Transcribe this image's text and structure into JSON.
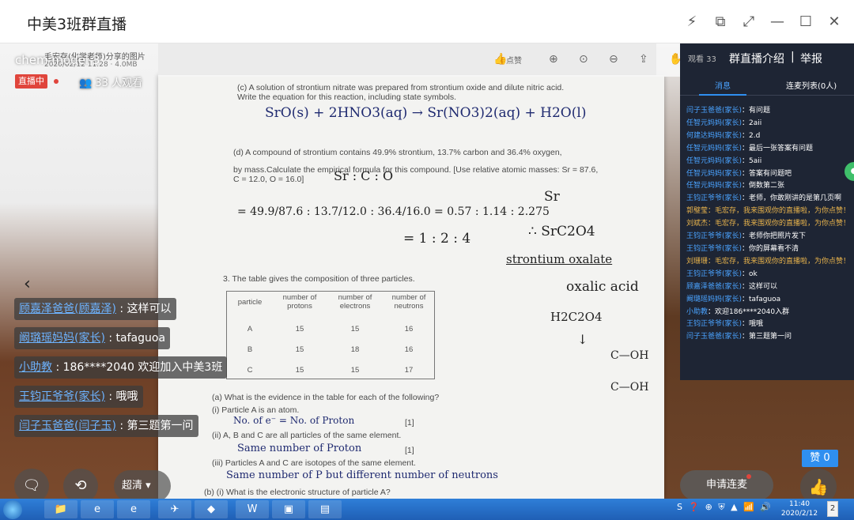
{
  "window": {
    "title": "中美3班群直播",
    "controls": [
      "⚡",
      "⧉",
      "⤢",
      "—",
      "☐",
      "✕"
    ]
  },
  "viewer": {
    "room_name": "chem model 3",
    "image_meta": "毛宏存(化学老师)分享的图片",
    "image_meta2": "2020/02/12 11:28 · 4.0MB",
    "like_label": "点赞",
    "toolbar_icons": [
      "like-icon",
      "zoom-in-icon",
      "zoom-out-icon",
      "zoom-reset-icon",
      "share-icon",
      "hand-icon"
    ]
  },
  "live": {
    "badge": "直播中",
    "viewers": "33 人观看"
  },
  "worksheet": {
    "q_top": "(c) A solution of strontium nitrate was prepared from strontium oxide and dilute nitric acid.",
    "q_top2": "Write the equation for this reaction, including state symbols.",
    "hw_eq1": "SrO(s) + 2HNO3(aq) →  Sr(NO3)2(aq) +  H2O(l)",
    "q_d": "(d) A compound of strontium contains 49.9% strontium, 13.7% carbon and 36.4% oxygen,",
    "q_d2": "by mass.Calculate the empirical formula for this compound. [Use relative atomic masses: Sr = 87.6,",
    "q_d3": "C = 12.0, O = 16.0]",
    "hw_ratio_head": "Sr : C : O",
    "hw_calc": "= 49.9/87.6 : 13.7/12.0 : 36.4/16.0 = 0.57 : 1.14 : 2.275",
    "hw_simpl": "= 1 : 2 : 4",
    "hw_sr": "Sr",
    "hw_formula": "∴ SrC2O4",
    "hw_name": "strontium oxalate",
    "hw_acid": "oxalic acid",
    "hw_acid_f": "H2C2O4",
    "hw_arrow": "↓",
    "hw_struct": "C—OH",
    "hw_struct2": "C—OH",
    "q3": "3. The table gives the composition of three particles.",
    "table": {
      "headers": [
        "particle",
        "number of protons",
        "number of electrons",
        "number of neutrons"
      ],
      "rows": [
        [
          "A",
          "15",
          "15",
          "16"
        ],
        [
          "B",
          "15",
          "18",
          "16"
        ],
        [
          "C",
          "15",
          "15",
          "17"
        ]
      ]
    },
    "qa": "(a) What is the evidence in the table for each of the following?",
    "qa_i": "(i) Particle A is an atom.",
    "hw_ai": "No. of e⁻ = No. of Proton",
    "mark1": "[1]",
    "qa_ii": "(ii) A, B and C are all particles of the same element.",
    "hw_aii": "Same number of Proton",
    "mark2": "[1]",
    "qa_iii": "(iii) Particles A and C are isotopes of the same element.",
    "hw_aiii": "Same number of P but different number of neutrons",
    "qb": "(b) (i) What is the electronic structure of particle A?"
  },
  "danmaku": [
    {
      "user": "顾嘉泽爸爸(顾嘉泽)",
      "text": " : 这样可以"
    },
    {
      "user": "阚璐瑶妈妈(家长)",
      "text": " : tafaguoa"
    },
    {
      "user": "小助教",
      "text": " : 186****2040 欢迎加入中美3班"
    },
    {
      "user": "王钧正爷爷(家长)",
      "text": " : 哦哦"
    },
    {
      "user": "闫子玉爸爸(闫子玉)",
      "text": " : 第三题第一问"
    }
  ],
  "controls": {
    "quality": "超清",
    "apply": "申请连麦",
    "zan": "赞 0"
  },
  "chat": {
    "watch": "观看 33",
    "intro": "群直播介绍",
    "sep": "|",
    "report": "举报",
    "tab_msgs": "消息",
    "tab_mic": "连麦列表(0人)",
    "messages": [
      {
        "user": "闫子玉爸爸(家长)",
        "text": "：有问题",
        "sys": false
      },
      {
        "user": "任智元妈妈(家长)",
        "text": "：2aii",
        "sys": false
      },
      {
        "user": "何建达妈妈(家长)",
        "text": "：2.d",
        "sys": false
      },
      {
        "user": "任智元妈妈(家长)",
        "text": "：最后一张答案有问题",
        "sys": false
      },
      {
        "user": "任智元妈妈(家长)",
        "text": "：5aii",
        "sys": false
      },
      {
        "user": "任智元妈妈(家长)",
        "text": "：答案有问题吧",
        "sys": false
      },
      {
        "user": "任智元妈妈(家长)",
        "text": "：倒数第二张",
        "sys": false
      },
      {
        "user": "王钧正爷爷(家长)",
        "text": "：老师，你敢刚讲的是第几页啊",
        "sys": false
      },
      {
        "user": "郭璧莹",
        "text": "：毛宏存，我来围观你的直播啦，为你点赞！",
        "sys": true
      },
      {
        "user": "刘斌杰",
        "text": "：毛宏存，我来围观你的直播啦，为你点赞！",
        "sys": true
      },
      {
        "user": "王钧正爷爷(家长)",
        "text": "：老师你把照片发下",
        "sys": false
      },
      {
        "user": "王钧正爷爷(家长)",
        "text": "：你的屏幕看不清",
        "sys": false
      },
      {
        "user": "刘珊珊",
        "text": "：毛宏存，我来围观你的直播啦，为你点赞！",
        "sys": true
      },
      {
        "user": "王钧正爷爷(家长)",
        "text": "：ok",
        "sys": false
      },
      {
        "user": "顾嘉泽爸爸(家长)",
        "text": "：这样可以",
        "sys": false
      },
      {
        "user": "阚璐瑶妈妈(家长)",
        "text": "：tafaguoa",
        "sys": false
      },
      {
        "user": "小助教",
        "text": "：欢迎186****2040入群",
        "sys": false
      },
      {
        "user": "王钧正爷爷(家长)",
        "text": "：哦哦",
        "sys": false
      },
      {
        "user": "闫子玉爸爸(家长)",
        "text": "：第三题第一问",
        "sys": false
      }
    ]
  },
  "taskbar": {
    "time": "11:40",
    "date": "2020/2/12",
    "tray": "S ❓ ⊕ ⛨ ▲ 📶 🔊",
    "show_desktop": "2"
  }
}
